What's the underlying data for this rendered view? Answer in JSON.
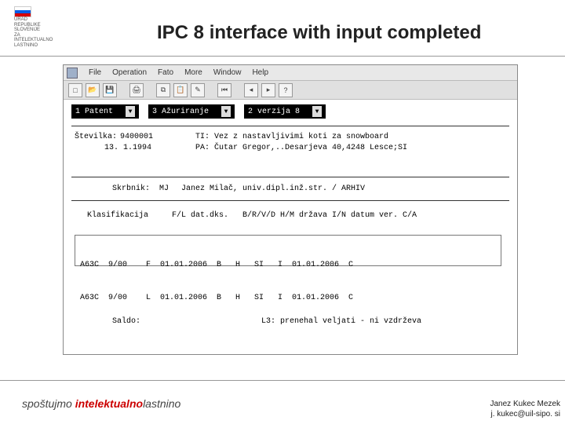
{
  "header": {
    "logo_text": "URAD\nREPUBLIKE\nSLOVENIJE\nZA\nINTELEKTUALNO\nLASTNINO",
    "title": "IPC 8 interface with input completed"
  },
  "window": {
    "menubar": {
      "items": [
        "File",
        "Operation",
        "Fato",
        "More",
        "Window",
        "Help"
      ]
    },
    "toolbar": {
      "icons": [
        "new",
        "open",
        "save",
        "print",
        "copy",
        "paste",
        "text",
        "nav-first",
        "nav-left",
        "nav-right",
        "help"
      ]
    },
    "combos": [
      {
        "label": "1  Patent"
      },
      {
        "label": "3  Ažuriranje"
      },
      {
        "label": "2  verzija 8"
      }
    ],
    "fields": {
      "stevilka_lbl": "Številka:",
      "stevilka_val": "9400001",
      "datum": "13. 1.1994",
      "ti_lbl": "TI:",
      "ti_val": "Vez z nastavljivimi koti za snowboard",
      "pa_lbl": "PA:",
      "pa_val": "Čutar Gregor,..Desarjeva 40,4248 Lesce;SI",
      "skrbnik_lbl": "Skrbnik:",
      "skrbnik_code": "MJ",
      "skrbnik_val": "Janez Milač, univ.dipl.inž.str. / ARHIV",
      "klas_lbl": "Klasifikacija",
      "klas_hdr": "F/L dat.dks.   B/R/V/D H/M država I/N datum ver. C/A"
    },
    "class_rows": [
      "A63C  9/00    F  01.01.2006  B   H   SI   I  01.01.2006  C",
      "A63C  9/00    L  01.01.2006  B   H   SI   I  01.01.2006  C"
    ],
    "bottom": {
      "saldo_lbl": "Saldo:",
      "l3_lbl": "L3:",
      "l3_val": "prenehal veljati - ni vzdrževa"
    }
  },
  "footer": {
    "logo_left": "spoštujmo",
    "logo_mid": "intelektualno",
    "logo_right": "lastnino",
    "name": "Janez Kukec Mezek",
    "email": "j. kukec@uil-sipo. si"
  }
}
